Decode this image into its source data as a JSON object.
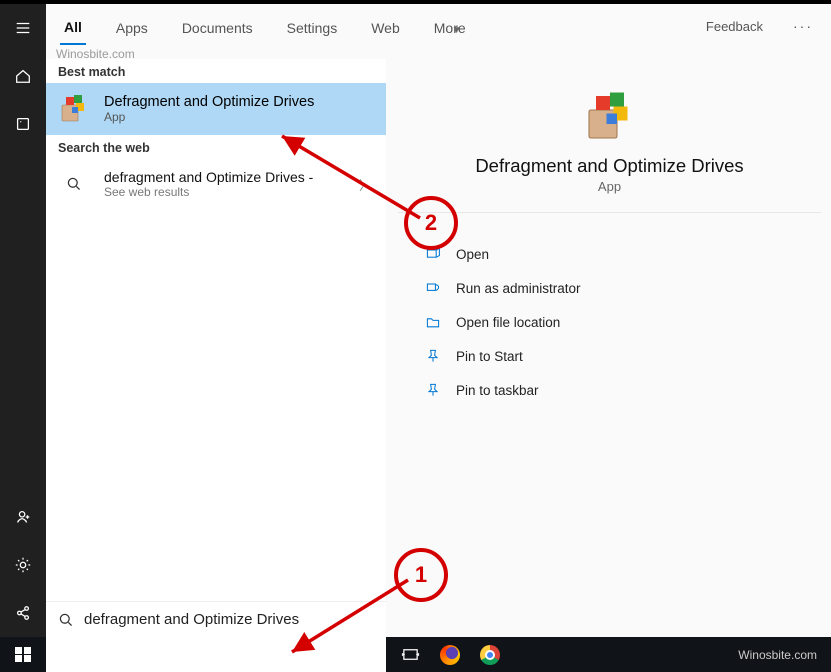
{
  "tabs": {
    "items": [
      "All",
      "Apps",
      "Documents",
      "Settings",
      "Web",
      "More"
    ],
    "active_index": 0,
    "feedback": "Feedback"
  },
  "watermark_top": "Winosbite.com",
  "left": {
    "best_match_label": "Best match",
    "best_match": {
      "title": "Defragment and Optimize Drives",
      "sub": "App"
    },
    "web_label": "Search the web",
    "web_item": {
      "title": "defragment and Optimize Drives -",
      "sub": "See web results"
    }
  },
  "detail": {
    "title": "Defragment and Optimize Drives",
    "sub": "App",
    "actions": [
      {
        "icon": "open-icon",
        "label": "Open"
      },
      {
        "icon": "shield-icon",
        "label": "Run as administrator"
      },
      {
        "icon": "folder-icon",
        "label": "Open file location"
      },
      {
        "icon": "pin-start-icon",
        "label": "Pin to Start"
      },
      {
        "icon": "pin-taskbar-icon",
        "label": "Pin to taskbar"
      }
    ]
  },
  "search": {
    "value": "defragment and Optimize Drives"
  },
  "taskbar": {
    "brand": "Winosbite.com"
  },
  "annotations": {
    "one": "1",
    "two": "2"
  }
}
